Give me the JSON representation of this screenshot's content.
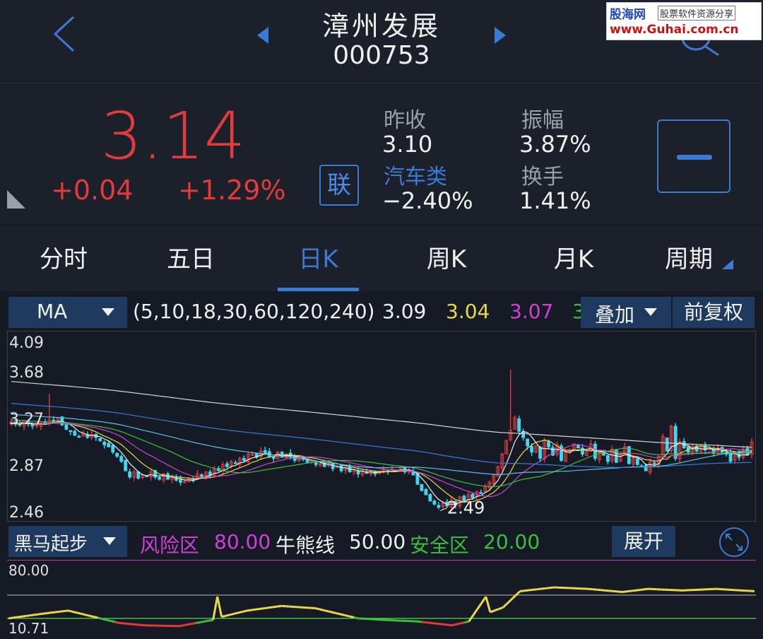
{
  "header": {
    "stock_name": "漳州发展",
    "stock_code": "000753",
    "watermark": {
      "logo": "股海网",
      "tagline": "股票软件资源分享",
      "url": "www.Guhai.com.cn"
    }
  },
  "quote": {
    "price": "3.14",
    "change_abs": "+0.04",
    "change_pct": "+1.29%",
    "link_label": "联",
    "prev_close_label": "昨收",
    "prev_close": "3.10",
    "amplitude_label": "振幅",
    "amplitude": "3.87%",
    "sector_label": "汽车类",
    "sector_change": "−2.40%",
    "turnover_label": "换手",
    "turnover": "1.41%",
    "colors": {
      "up": "#e23b3b",
      "accent": "#3b7bd6"
    }
  },
  "tabs": [
    "分时",
    "五日",
    "日K",
    "周K",
    "月K",
    "周期"
  ],
  "active_tab": "日K",
  "ma_bar": {
    "indicator": "MA",
    "params": "(5,10,18,30,60,120,240)",
    "values": [
      {
        "text": "3.09",
        "color": "#f0f0f0"
      },
      {
        "text": "3.04",
        "color": "#e8d84a"
      },
      {
        "text": "3.07",
        "color": "#d040d8"
      },
      {
        "text": "3",
        "color": "#3cbf3c"
      }
    ],
    "overlay_label": "叠加",
    "adjust_label": "前复权"
  },
  "indicator_bar": {
    "name": "黑马起步",
    "risk_label": "风险区",
    "risk_value": "80.00",
    "bull_bear_label": "牛熊线",
    "bull_bear_value": "50.00",
    "safe_label": "安全区",
    "safe_value": "20.00",
    "expand_label": "展开"
  },
  "chart_data": [
    {
      "type": "candlestick",
      "title": "日K",
      "y_ticks": [
        "4.09",
        "3.68",
        "3.27",
        "2.87",
        "2.46"
      ],
      "ylim": [
        2.46,
        4.09
      ],
      "low_annotation": "2.49",
      "n_bars": 176,
      "closes": [
        3.33,
        3.31,
        3.3,
        3.34,
        3.31,
        3.29,
        3.3,
        3.32,
        3.31,
        3.35,
        3.34,
        3.37,
        3.3,
        3.26,
        3.24,
        3.2,
        3.19,
        3.22,
        3.18,
        3.21,
        3.18,
        3.15,
        3.11,
        3.09,
        3.04,
        3.0,
        2.95,
        2.86,
        2.8,
        2.85,
        2.79,
        2.82,
        2.81,
        2.85,
        2.8,
        2.78,
        2.83,
        2.78,
        2.8,
        2.77,
        2.75,
        2.76,
        2.79,
        2.77,
        2.83,
        2.8,
        2.85,
        2.82,
        2.88,
        2.86,
        2.92,
        2.9,
        2.95,
        2.93,
        2.98,
        2.96,
        3.02,
        3.03,
        2.99,
        3.05,
        3.03,
        3.0,
        2.98,
        3.04,
        2.99,
        3.02,
        3.0,
        2.96,
        3.0,
        2.97,
        2.94,
        2.95,
        2.92,
        2.93,
        2.9,
        2.92,
        2.88,
        2.9,
        2.86,
        2.89,
        2.85,
        2.87,
        2.83,
        2.85,
        2.84,
        2.86,
        2.83,
        2.85,
        2.87,
        2.85,
        2.88,
        2.86,
        2.89,
        2.85,
        2.87,
        2.82,
        2.73,
        2.67,
        2.63,
        2.57,
        2.54,
        2.51,
        2.55,
        2.52,
        2.58,
        2.53,
        2.61,
        2.57,
        2.63,
        2.6,
        2.66,
        2.65,
        2.71,
        2.75,
        2.82,
        2.9,
        3.02,
        3.15,
        3.25,
        3.37,
        3.24,
        3.18,
        3.1,
        3.04,
        3.1,
        2.98,
        3.15,
        3.09,
        3.01,
        3.11,
        2.96,
        3.05,
        3.06,
        3.12,
        3.08,
        3.02,
        3.05,
        3.12,
        2.98,
        3.05,
        3.01,
        2.95,
        3.07,
        2.94,
        3.02,
        3.09,
        2.93,
        2.98,
        2.92,
        2.9,
        2.86,
        2.95,
        2.93,
        3.0,
        3.19,
        3.05,
        3.29,
        2.98,
        3.14,
        3.08,
        3.04,
        3.1,
        3.05,
        3.09,
        3.06,
        3.08,
        3.03,
        3.08,
        3.04,
        3.02,
        2.95,
        3.04,
        2.99,
        3.07,
        3.01,
        3.14
      ],
      "ma_series": [
        {
          "name": "MA5",
          "color": "#f0f0f0"
        },
        {
          "name": "MA10",
          "color": "#e8d84a"
        },
        {
          "name": "MA18",
          "color": "#d040d8"
        },
        {
          "name": "MA30",
          "color": "#3cbf3c"
        },
        {
          "name": "MA60",
          "color": "#58c0e8"
        },
        {
          "name": "MA120",
          "color": "#3a78d8"
        },
        {
          "name": "MA240",
          "color": "#d8d8d8"
        }
      ],
      "colors": {
        "up": "#e23b3b",
        "down": "#3ed6f0"
      }
    },
    {
      "type": "line",
      "title": "黑马起步",
      "y_ticks": [
        "80.00",
        "10.71"
      ],
      "ylim": [
        10.71,
        80.0
      ],
      "reference_lines": [
        {
          "value": 50.0,
          "color": "#888888"
        },
        {
          "value": 20.0,
          "color": "#3cbf3c"
        }
      ],
      "n_points": 176,
      "x_range": [
        0,
        175
      ],
      "keyframes": [
        [
          0,
          20
        ],
        [
          8,
          26
        ],
        [
          14,
          30
        ],
        [
          20,
          22
        ],
        [
          26,
          14
        ],
        [
          32,
          11
        ],
        [
          40,
          10
        ],
        [
          48,
          18
        ],
        [
          49,
          48
        ],
        [
          50,
          22
        ],
        [
          56,
          30
        ],
        [
          64,
          36
        ],
        [
          72,
          33
        ],
        [
          82,
          20
        ],
        [
          88,
          18
        ],
        [
          96,
          16
        ],
        [
          104,
          11
        ],
        [
          108,
          16
        ],
        [
          112,
          48
        ],
        [
          113,
          28
        ],
        [
          116,
          34
        ],
        [
          120,
          55
        ],
        [
          128,
          60
        ],
        [
          136,
          58
        ],
        [
          144,
          54
        ],
        [
          150,
          58
        ],
        [
          158,
          56
        ],
        [
          166,
          58
        ],
        [
          175,
          55
        ]
      ],
      "colors": {
        "rising": "#e8d84a",
        "low": "#e23b3b",
        "mid": "#3cbf3c"
      }
    }
  ]
}
